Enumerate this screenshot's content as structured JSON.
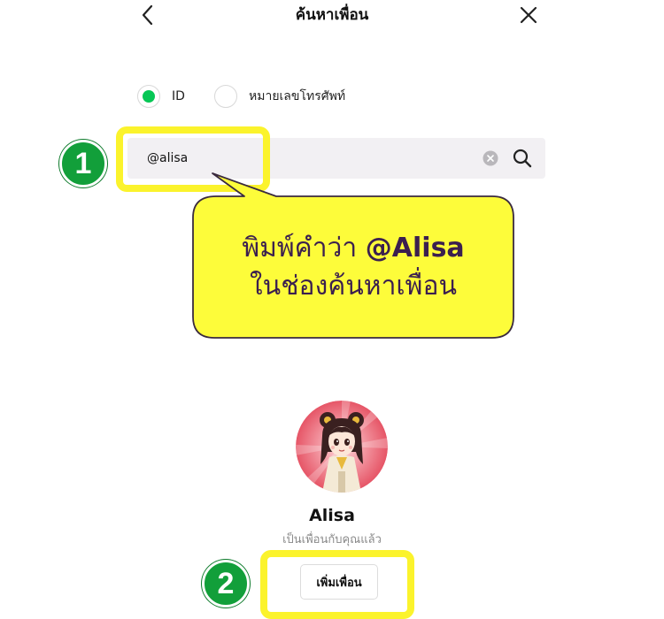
{
  "header": {
    "title": "ค้นหาเพื่อน",
    "back_icon": "chevron-left-icon",
    "close_icon": "close-icon"
  },
  "search_type": {
    "options": [
      {
        "label": "ID",
        "selected": true
      },
      {
        "label": "หมายเลขโทรศัพท์",
        "selected": false
      }
    ]
  },
  "search": {
    "value": "@alisa",
    "placeholder": ""
  },
  "annotations": {
    "step1": "1",
    "step2": "2",
    "callout_line1_prefix": "พิมพ์คำว่า ",
    "callout_line1_bold": "@Alisa",
    "callout_line2": "ในช่องค้นหาเพื่อน"
  },
  "result": {
    "name": "Alisa",
    "status": "เป็นเพื่อนกับคุณแล้ว",
    "add_button_label": "เพิ่มเพื่อน"
  },
  "colors": {
    "accent_green": "#06c755",
    "highlight_yellow": "#fbf32c",
    "badge_green": "#129f3a",
    "callout_text": "#3b1f4f"
  }
}
